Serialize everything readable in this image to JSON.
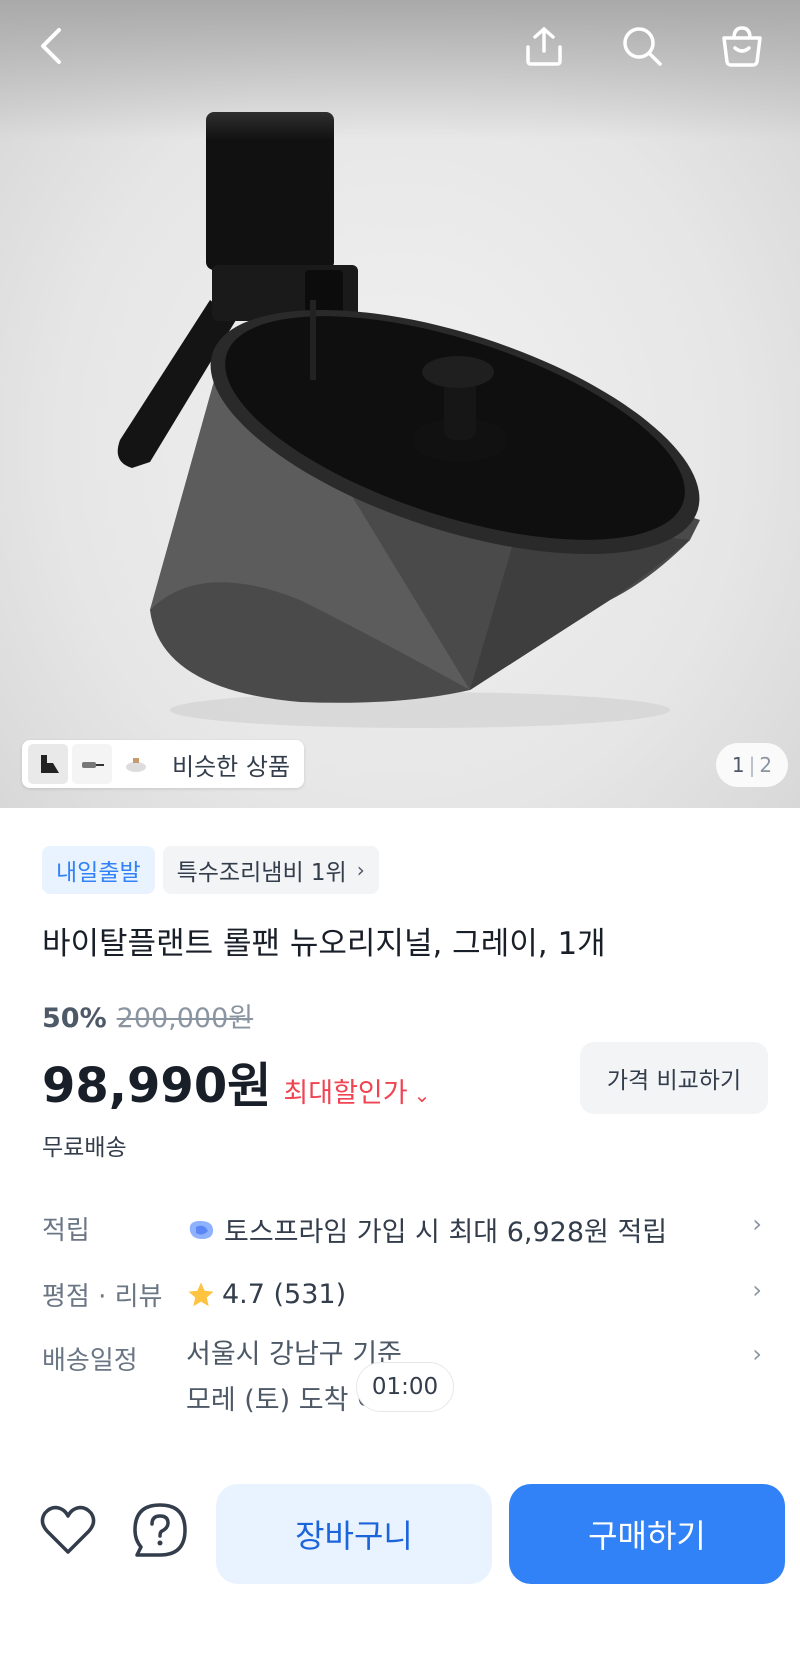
{
  "hero": {
    "similar_label": "비슷한 상품",
    "pager_current": "1",
    "pager_total": "2"
  },
  "tags": {
    "delivery_badge": "내일출발",
    "ranking_badge": "특수조리냄비 1위"
  },
  "product": {
    "title": "바이탈플랜트 롤팬 뉴오리지널, 그레이, 1개",
    "discount_rate": "50%",
    "original_price": "200,000원",
    "price": "98,990원",
    "max_discount_label": "최대할인가",
    "compare_button": "가격 비교하기",
    "shipping_fee": "무료배송"
  },
  "info": {
    "points_label": "적립",
    "points_value": "토스프라임 가입 시 최대 6,928원 적립",
    "rating_label": "평점 · 리뷰",
    "rating_value": "4.7 (531)",
    "schedule_label": "배송일정",
    "schedule_line1": "서울시 강남구 기준",
    "schedule_line2": "모레 (토) 도착 예정",
    "timer": "01:00"
  },
  "bottom_bar": {
    "cart_button": "장바구니",
    "buy_button": "구매하기"
  },
  "colors": {
    "primary": "#3182f6",
    "primary_light": "#e8f3ff",
    "sale_red": "#f04452",
    "star": "#ffc342"
  },
  "icons": [
    "back-arrow-icon",
    "share-icon",
    "search-icon",
    "shopping-bag-icon",
    "heart-icon",
    "question-icon",
    "chevron-right-icon",
    "chevron-down-icon",
    "star-icon",
    "toss-prime-icon"
  ]
}
